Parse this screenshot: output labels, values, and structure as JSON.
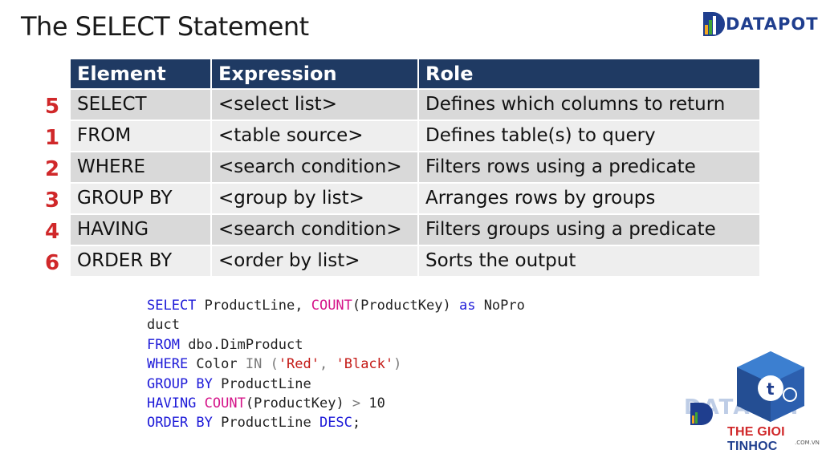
{
  "slide": {
    "title": "The SELECT Statement"
  },
  "logo": {
    "text": "DATAPOT",
    "mark_icon": "datapot-bar-chart-icon"
  },
  "table": {
    "headers": [
      "Element",
      "Expression",
      "Role"
    ],
    "rows": [
      {
        "order": "5",
        "element": "SELECT",
        "expression": "<select list>",
        "role": "Defines which columns to return"
      },
      {
        "order": "1",
        "element": "FROM",
        "expression": "<table source>",
        "role": "Defines table(s) to query"
      },
      {
        "order": "2",
        "element": "WHERE",
        "expression": "<search condition>",
        "role": "Filters rows using a predicate"
      },
      {
        "order": "3",
        "element": "GROUP BY",
        "expression": "<group by list>",
        "role": "Arranges rows by groups"
      },
      {
        "order": "4",
        "element": "HAVING",
        "expression": "<search condition>",
        "role": "Filters groups using a predicate"
      },
      {
        "order": "6",
        "element": "ORDER BY",
        "expression": "<order by list>",
        "role": "Sorts the output"
      }
    ]
  },
  "code": {
    "lines": [
      [
        {
          "t": "SELECT",
          "c": "kw"
        },
        {
          "t": " ProductLine, ",
          "c": ""
        },
        {
          "t": "COUNT",
          "c": "fn"
        },
        {
          "t": "(ProductKey) ",
          "c": ""
        },
        {
          "t": "as",
          "c": "kw"
        },
        {
          "t": " NoPro",
          "c": ""
        }
      ],
      [
        {
          "t": "duct",
          "c": ""
        }
      ],
      [
        {
          "t": "FROM",
          "c": "kw"
        },
        {
          "t": " dbo.DimProduct",
          "c": ""
        }
      ],
      [
        {
          "t": "WHERE",
          "c": "kw"
        },
        {
          "t": " Color ",
          "c": ""
        },
        {
          "t": "IN",
          "c": "gray"
        },
        {
          "t": " (",
          "c": "gray"
        },
        {
          "t": "'Red'",
          "c": "str"
        },
        {
          "t": ", ",
          "c": "gray"
        },
        {
          "t": "'Black'",
          "c": "str"
        },
        {
          "t": ")",
          "c": "gray"
        }
      ],
      [
        {
          "t": "GROUP BY",
          "c": "kw"
        },
        {
          "t": " ProductLine",
          "c": ""
        }
      ],
      [
        {
          "t": "HAVING",
          "c": "kw"
        },
        {
          "t": " ",
          "c": ""
        },
        {
          "t": "COUNT",
          "c": "fn"
        },
        {
          "t": "(ProductKey) ",
          "c": ""
        },
        {
          "t": ">",
          "c": "gray"
        },
        {
          "t": " 10",
          "c": ""
        }
      ],
      [
        {
          "t": "ORDER BY",
          "c": "kw"
        },
        {
          "t": " ProductLine ",
          "c": ""
        },
        {
          "t": "DESC",
          "c": "kw"
        },
        {
          "t": ";",
          "c": ""
        }
      ]
    ]
  },
  "watermark": {
    "faint_logo": "DATAPOT",
    "brand_red": "THE GIOI",
    "brand_blue": "TINHOC",
    "sub": ".COM.VN",
    "icon": "thegioitinhoc-cube-icon"
  },
  "colors": {
    "header_bg": "#1f3a63",
    "row_odd": "#d9d9d9",
    "row_even": "#eeeeee",
    "order_red": "#d0282a",
    "keyword_blue": "#1d1ad8",
    "function_pink": "#d5158a",
    "string_red": "#c41a16"
  }
}
